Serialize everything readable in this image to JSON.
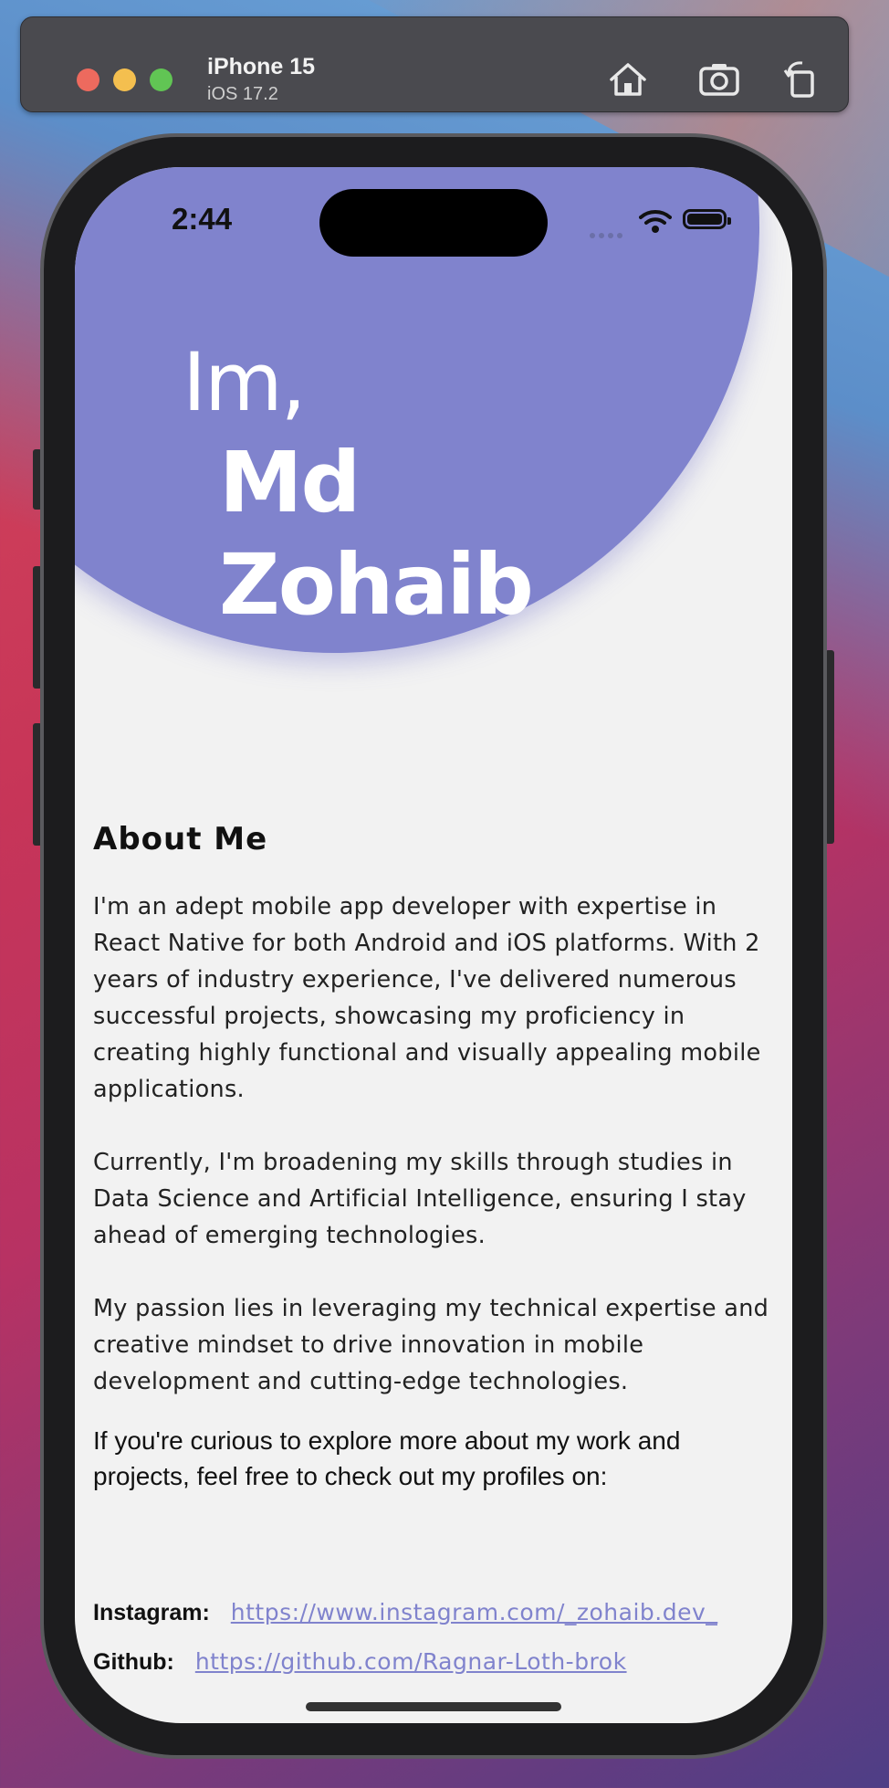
{
  "simulator": {
    "device_name": "iPhone 15",
    "os_version": "iOS 17.2",
    "icons": [
      "home-icon",
      "screenshot-icon",
      "rotate-icon"
    ]
  },
  "status_bar": {
    "time": "2:44",
    "icons": [
      "wifi-icon",
      "battery-icon"
    ]
  },
  "hero": {
    "greeting": "Im,",
    "first_name": "Md",
    "last_name": "Zohaib",
    "accent_color": "#8083cd"
  },
  "about": {
    "heading": "About Me",
    "paragraphs": [
      "I'm an adept mobile app developer with expertise in React Native for both Android and iOS platforms. With 2 years of industry experience, I've delivered numerous successful projects, showcasing my proficiency in creating highly functional and visually appealing mobile applications.",
      "Currently, I'm broadening my skills through studies in Data Science and Artificial Intelligence, ensuring I stay ahead of emerging technologies.",
      "My passion lies in leveraging my technical expertise and creative mindset to drive innovation in mobile development and cutting-edge technologies."
    ],
    "cta": "If you're curious to explore more about my work and projects, feel free to check out my profiles on:"
  },
  "links": [
    {
      "label": "Instagram:",
      "url": "https://www.instagram.com/_zohaib.dev_"
    },
    {
      "label": "Github:",
      "url": "https://github.com/Ragnar-Loth-brok"
    }
  ]
}
